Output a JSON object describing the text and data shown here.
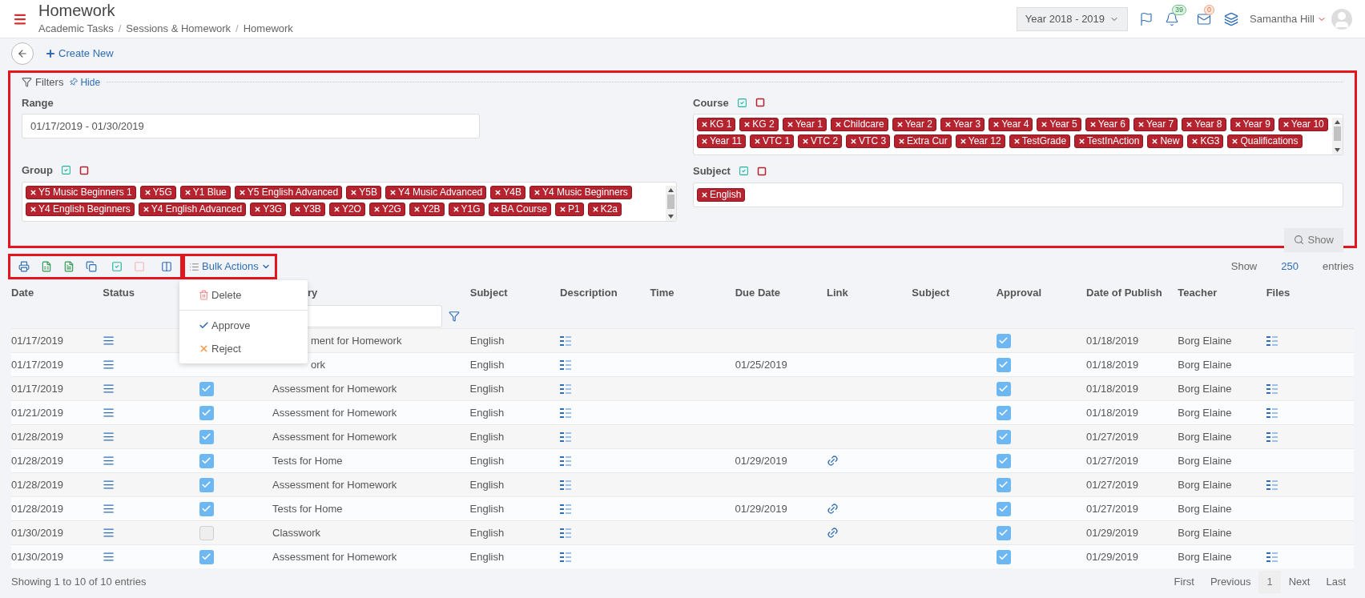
{
  "header": {
    "title": "Homework",
    "breadcrumb": [
      "Academic Tasks",
      "Sessions & Homework",
      "Homework"
    ],
    "breadcrumb_separator": "/",
    "year": "Year 2018 - 2019",
    "notifications": "39",
    "messages": "0",
    "user": "Samantha Hill"
  },
  "actions": {
    "create": "Create New"
  },
  "filters": {
    "legend": "Filters",
    "hide": "Hide",
    "range": {
      "label": "Range",
      "value": "01/17/2019 - 01/30/2019"
    },
    "group": {
      "label": "Group",
      "tags": [
        "Y5 Music Beginners 1",
        "Y5G",
        "Y1 Blue",
        "Y5 English Advanced",
        "Y5B",
        "Y4 Music Advanced",
        "Y4B",
        "Y4 Music Beginners",
        "Y4 English Beginners",
        "Y4 English Advanced",
        "Y3G",
        "Y3B",
        "Y2O",
        "Y2G",
        "Y2B",
        "Y1G",
        "BA Course",
        "P1",
        "K2a"
      ]
    },
    "course": {
      "label": "Course",
      "tags": [
        "KG 1",
        "KG 2",
        "Year 1",
        "Childcare",
        "Year 2",
        "Year 3",
        "Year 4",
        "Year 5",
        "Year 6",
        "Year 7",
        "Year 8",
        "Year 9",
        "Year 10",
        "Year 11",
        "VTC 1",
        "VTC 2",
        "VTC 3",
        "Extra Cur",
        "Year 12",
        "TestGrade",
        "TestInAction",
        "New",
        "KG3",
        "Qualifications"
      ]
    },
    "subject": {
      "label": "Subject",
      "tags": [
        "English"
      ]
    },
    "show": "Show"
  },
  "table_tools": {
    "bulk": "Bulk Actions",
    "menu_open": true,
    "menu": [
      {
        "kind": "delete",
        "label": "Delete"
      },
      {
        "kind": "approve",
        "label": "Approve"
      },
      {
        "kind": "reject",
        "label": "Reject"
      }
    ],
    "show_label": "Show",
    "page_size": "250",
    "entries": "entries"
  },
  "table": {
    "columns": [
      {
        "label": "Date"
      },
      {
        "label": "Status"
      },
      {
        "label": "ry",
        "covered": true
      },
      {
        "label": "Subject"
      },
      {
        "label": "Description"
      },
      {
        "label": "Time"
      },
      {
        "label": "Due Date"
      },
      {
        "label": "Link"
      },
      {
        "label": "Subject"
      },
      {
        "label": "Approval"
      },
      {
        "label": "Date of Publish"
      },
      {
        "label": "Teacher"
      },
      {
        "label": "Files"
      }
    ],
    "rows": [
      {
        "date": "01/17/2019",
        "category": "ment for Homework",
        "covered": true,
        "subject": "English",
        "link": false,
        "approval": true,
        "published": "01/18/2019",
        "teacher": "Borg Elaine",
        "files": true
      },
      {
        "date": "01/17/2019",
        "category": "ork",
        "covered": true,
        "subject": "English",
        "due": "01/25/2019",
        "link": false,
        "approval": true,
        "published": "01/18/2019",
        "teacher": "Borg Elaine",
        "files": false
      },
      {
        "date": "01/17/2019",
        "checked": true,
        "category": "Assessment for Homework",
        "covered": false,
        "subject": "English",
        "link": false,
        "approval": true,
        "published": "01/18/2019",
        "teacher": "Borg Elaine",
        "files": true
      },
      {
        "date": "01/21/2019",
        "checked": true,
        "category": "Assessment for Homework",
        "covered": false,
        "subject": "English",
        "link": false,
        "approval": true,
        "published": "01/18/2019",
        "teacher": "Borg Elaine",
        "files": true
      },
      {
        "date": "01/28/2019",
        "checked": true,
        "category": "Assessment for Homework",
        "covered": false,
        "subject": "English",
        "link": false,
        "approval": true,
        "published": "01/27/2019",
        "teacher": "Borg Elaine",
        "files": true
      },
      {
        "date": "01/28/2019",
        "checked": true,
        "category": "Tests for Home",
        "covered": false,
        "subject": "English",
        "due": "01/29/2019",
        "link": true,
        "approval": true,
        "published": "01/27/2019",
        "teacher": "Borg Elaine",
        "files": false
      },
      {
        "date": "01/28/2019",
        "checked": true,
        "category": "Assessment for Homework",
        "covered": false,
        "subject": "English",
        "link": false,
        "approval": true,
        "published": "01/27/2019",
        "teacher": "Borg Elaine",
        "files": true
      },
      {
        "date": "01/28/2019",
        "checked": true,
        "category": "Tests for Home",
        "covered": false,
        "subject": "English",
        "due": "01/29/2019",
        "link": true,
        "approval": true,
        "published": "01/27/2019",
        "teacher": "Borg Elaine",
        "files": false
      },
      {
        "date": "01/30/2019",
        "checked": false,
        "category": "Classwork",
        "covered": false,
        "subject": "English",
        "link": true,
        "approval": true,
        "published": "01/29/2019",
        "teacher": "Borg Elaine",
        "files": false
      },
      {
        "date": "01/30/2019",
        "checked": true,
        "category": "Assessment for Homework",
        "covered": false,
        "subject": "English",
        "link": false,
        "approval": true,
        "published": "01/29/2019",
        "teacher": "Borg Elaine",
        "files": true
      }
    ]
  },
  "footer": {
    "info": "Showing 1 to 10 of 10 entries",
    "pages": [
      {
        "label": "First",
        "selected": false
      },
      {
        "label": "Previous",
        "selected": false
      },
      {
        "label": "1",
        "selected": true
      },
      {
        "label": "Next",
        "selected": false
      },
      {
        "label": "Last",
        "selected": false
      }
    ]
  }
}
